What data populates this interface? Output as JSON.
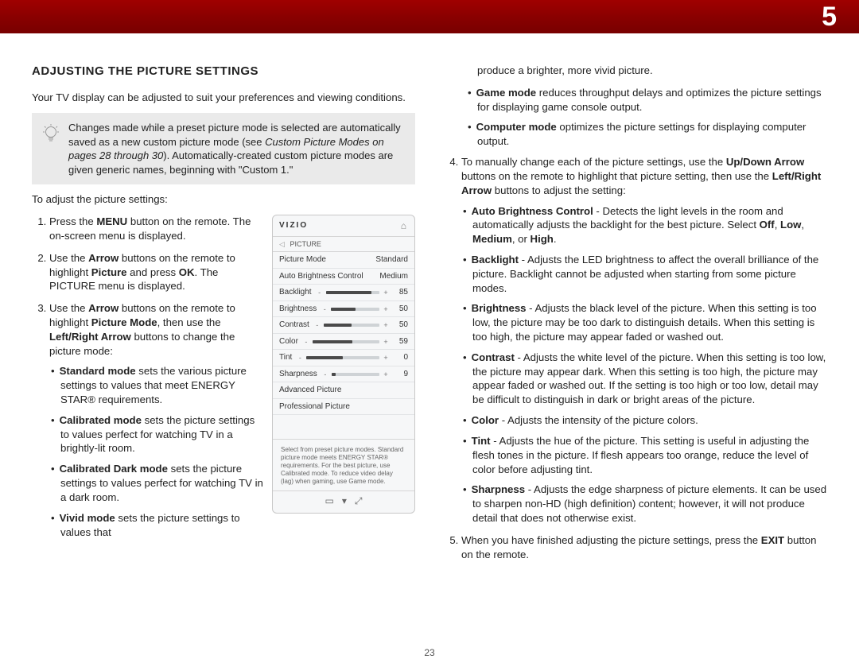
{
  "chapter": "5",
  "page_number": "23",
  "title": "ADJUSTING THE PICTURE SETTINGS",
  "intro": "Your TV display can be adjusted to suit your preferences and viewing conditions.",
  "note": {
    "pre": "Changes made while a preset picture mode is selected are automatically saved as a new custom picture mode (see ",
    "ital": "Custom Picture Modes on pages 28 through 30",
    "post": "). Automatically-created custom picture modes are given generic names, beginning with \"Custom 1.\""
  },
  "lead": "To adjust the picture settings:",
  "steps": {
    "s1": {
      "a": "Press the ",
      "b": "MENU",
      "c": " button on the remote. The on-screen menu is displayed."
    },
    "s2": {
      "a": "Use the ",
      "b": "Arrow",
      "c": " buttons on the remote to highlight ",
      "d": "Picture",
      "e": " and press ",
      "f": "OK",
      "g": ". The PICTURE menu is displayed."
    },
    "s3": {
      "a": "Use the ",
      "b": "Arrow",
      "c": " buttons on the remote to highlight ",
      "d": "Picture Mode",
      "e": ", then use the ",
      "f": "Left/Right Arrow",
      "g": " buttons to change the picture mode:"
    }
  },
  "modes": {
    "standard": {
      "h": "Standard mode",
      "t": " sets the various picture settings to values that meet ENERGY STAR® requirements."
    },
    "calibrated": {
      "h": "Calibrated mode",
      "t": " sets the picture settings to values perfect for watching TV in a brightly-lit room."
    },
    "calibdark": {
      "h": "Calibrated Dark mode",
      "t": " sets the picture settings to values perfect for watching TV in a dark room."
    },
    "vivid": {
      "h": "Vivid mode",
      "t": " sets the picture settings to values that "
    }
  },
  "col2": {
    "vivid_cont": "produce a brighter, more vivid picture.",
    "game": {
      "h": "Game mode",
      "t": " reduces throughput delays and optimizes the picture settings for displaying game console output."
    },
    "computer": {
      "h": "Computer mode",
      "t": " optimizes the picture settings for displaying computer output."
    },
    "step4": {
      "a": "To manually change each of the picture settings, use the ",
      "b": "Up/Down Arrow",
      "c": " buttons on the remote to highlight that picture setting, then use the ",
      "d": "Left/Right Arrow",
      "e": " buttons to adjust the setting:"
    },
    "auto": {
      "h": "Auto Brightness Control",
      "t1": " - Detects the light levels in the room and automatically adjusts the backlight for the best picture. Select ",
      "o1": "Off",
      "o2": "Low",
      "o3": "Medium",
      "o4": "High",
      "end": "."
    },
    "backlight": {
      "h": "Backlight",
      "t": " - Adjusts the LED brightness to affect the overall brilliance of the picture. Backlight cannot be adjusted when starting from some picture modes."
    },
    "brightness": {
      "h": "Brightness",
      "t": " - Adjusts the black level of the picture. When this setting is too low, the picture may be too dark to distinguish details. When this setting is too high, the picture may appear faded or washed out."
    },
    "contrast": {
      "h": "Contrast",
      "t": " - Adjusts the white level of the picture. When this setting is too low, the picture may appear dark. When this setting is too high, the picture may appear faded or washed out. If the setting is too high or too low, detail may be difficult to distinguish in dark or bright areas of the picture."
    },
    "color": {
      "h": "Color",
      "t": " - Adjusts the intensity of the picture colors."
    },
    "tint": {
      "h": "Tint",
      "t": " - Adjusts the hue of the picture. This setting is useful in adjusting the flesh tones in the picture. If flesh appears too orange, reduce the level of color before adjusting tint."
    },
    "sharpness": {
      "h": "Sharpness",
      "t": " - Adjusts the edge sharpness of picture elements. It can be used to sharpen non-HD (high definition) content; however, it will not produce detail that does not otherwise exist."
    },
    "step5": {
      "a": "When you have finished adjusting the picture settings, press the ",
      "b": "EXIT",
      "c": " button on the remote."
    }
  },
  "menu": {
    "brand": "VIZIO",
    "crumb": "PICTURE",
    "rows": {
      "mode": {
        "label": "Picture Mode",
        "value": "Standard"
      },
      "auto": {
        "label": "Auto Brightness Control",
        "value": "Medium"
      },
      "back": {
        "label": "Backlight",
        "value": "85",
        "pct": "85%"
      },
      "bright": {
        "label": "Brightness",
        "value": "50",
        "pct": "50%"
      },
      "contr": {
        "label": "Contrast",
        "value": "50",
        "pct": "50%"
      },
      "color": {
        "label": "Color",
        "value": "59",
        "pct": "59%"
      },
      "tint": {
        "label": "Tint",
        "value": "0",
        "pct": "50%"
      },
      "sharp": {
        "label": "Sharpness",
        "value": "9",
        "pct": "9%"
      },
      "adv": {
        "label": "Advanced Picture"
      },
      "pro": {
        "label": "Professional Picture"
      }
    },
    "help": "Select from preset picture modes. Standard picture mode meets ENERGY STAR® requirements. For the best picture, use Calibrated mode. To reduce video delay (lag) when gaming, use Game mode."
  }
}
